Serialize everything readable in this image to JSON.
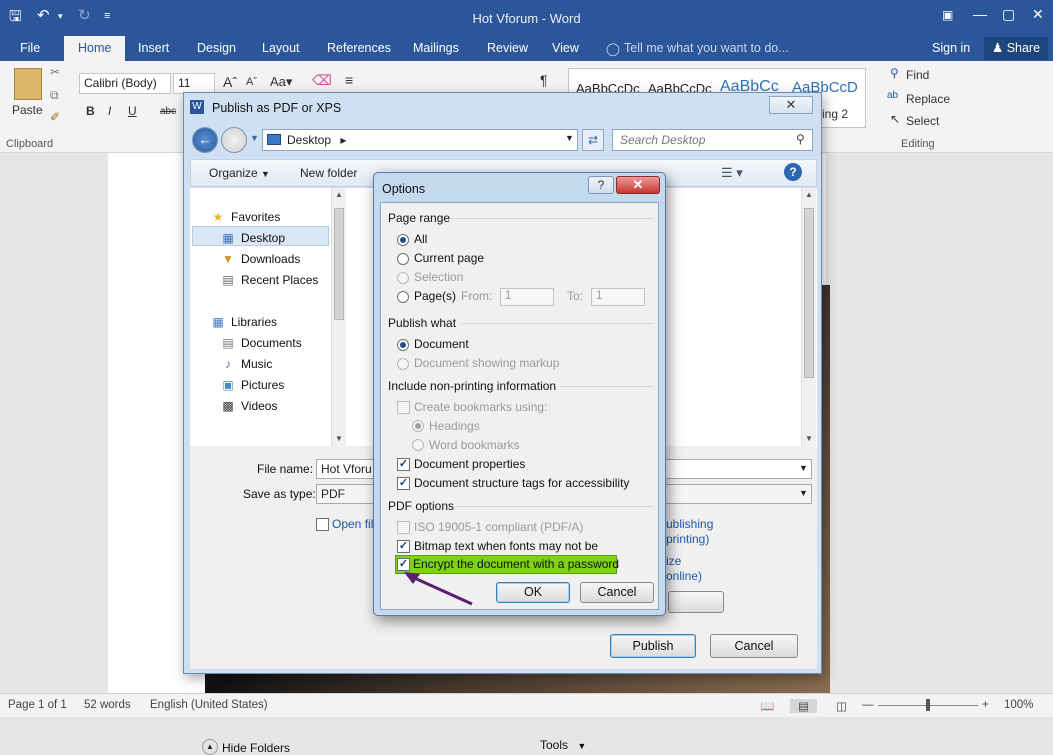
{
  "window": {
    "title": "Hot Vforum - Word"
  },
  "tabs": [
    {
      "label": "File"
    },
    {
      "label": "Home"
    },
    {
      "label": "Insert"
    },
    {
      "label": "Design"
    },
    {
      "label": "Layout"
    },
    {
      "label": "References"
    },
    {
      "label": "Mailings"
    },
    {
      "label": "Review"
    },
    {
      "label": "View"
    }
  ],
  "tell_me": "Tell me what you want to do...",
  "sign_in": "Sign in",
  "share": "Share",
  "ribbon": {
    "paste": "Paste",
    "clipboard": "Clipboard",
    "font_name": "Calibri (Body)",
    "font_size": "11",
    "style1": "AaBbCcDc",
    "style2": "AaBbCcDc",
    "style3": "AaBbCc",
    "style4": "AaBbCcD",
    "heading2": "ing 2",
    "find": "Find",
    "replace": "Replace",
    "select": "Select",
    "editing": "Editing"
  },
  "status": {
    "page": "Page 1 of 1",
    "words": "52 words",
    "language": "English (United States)",
    "zoom": "100%"
  },
  "publish": {
    "title": "Publish as PDF or XPS",
    "location": "Desktop",
    "search_placeholder": "Search Desktop",
    "organize": "Organize",
    "new_folder": "New folder",
    "nav": {
      "favorites": "Favorites",
      "desktop": "Desktop",
      "downloads": "Downloads",
      "recent": "Recent Places",
      "libraries": "Libraries",
      "documents": "Documents",
      "music": "Music",
      "pictures": "Pictures",
      "videos": "Videos"
    },
    "file_name_label": "File name:",
    "file_name_value": "Hot Vforu",
    "save_type_label": "Save as type:",
    "save_type_value": "PDF",
    "open_file": "Open fil",
    "publishing_1": "ublishing",
    "publishing_2": "printing)",
    "minimize_1": "ize",
    "minimize_2": "online)",
    "hide_folders": "Hide Folders",
    "tools": "Tools",
    "publish_btn": "Publish",
    "cancel_btn": "Cancel"
  },
  "options": {
    "title": "Options",
    "page_range": "Page range",
    "all": "All",
    "current_page": "Current page",
    "selection": "Selection",
    "pages": "Page(s)",
    "from": "From:",
    "from_val": "1",
    "to": "To:",
    "to_val": "1",
    "publish_what": "Publish what",
    "document": "Document",
    "document_markup": "Document showing markup",
    "non_printing": "Include non-printing information",
    "create_bookmarks": "Create bookmarks using:",
    "headings": "Headings",
    "word_bookmarks": "Word bookmarks",
    "doc_props": "Document properties",
    "doc_tags": "Document structure tags for accessibility",
    "pdf_options": "PDF options",
    "iso": "ISO 19005-1 compliant (PDF/A)",
    "bitmap": "Bitmap text when fonts may not be embedded",
    "encrypt": "Encrypt the document with a password",
    "ok": "OK",
    "cancel": "Cancel"
  },
  "colors": {
    "word_blue": "#2b579a",
    "highlight": "#7dd312",
    "arrow": "#5b1f6e"
  }
}
